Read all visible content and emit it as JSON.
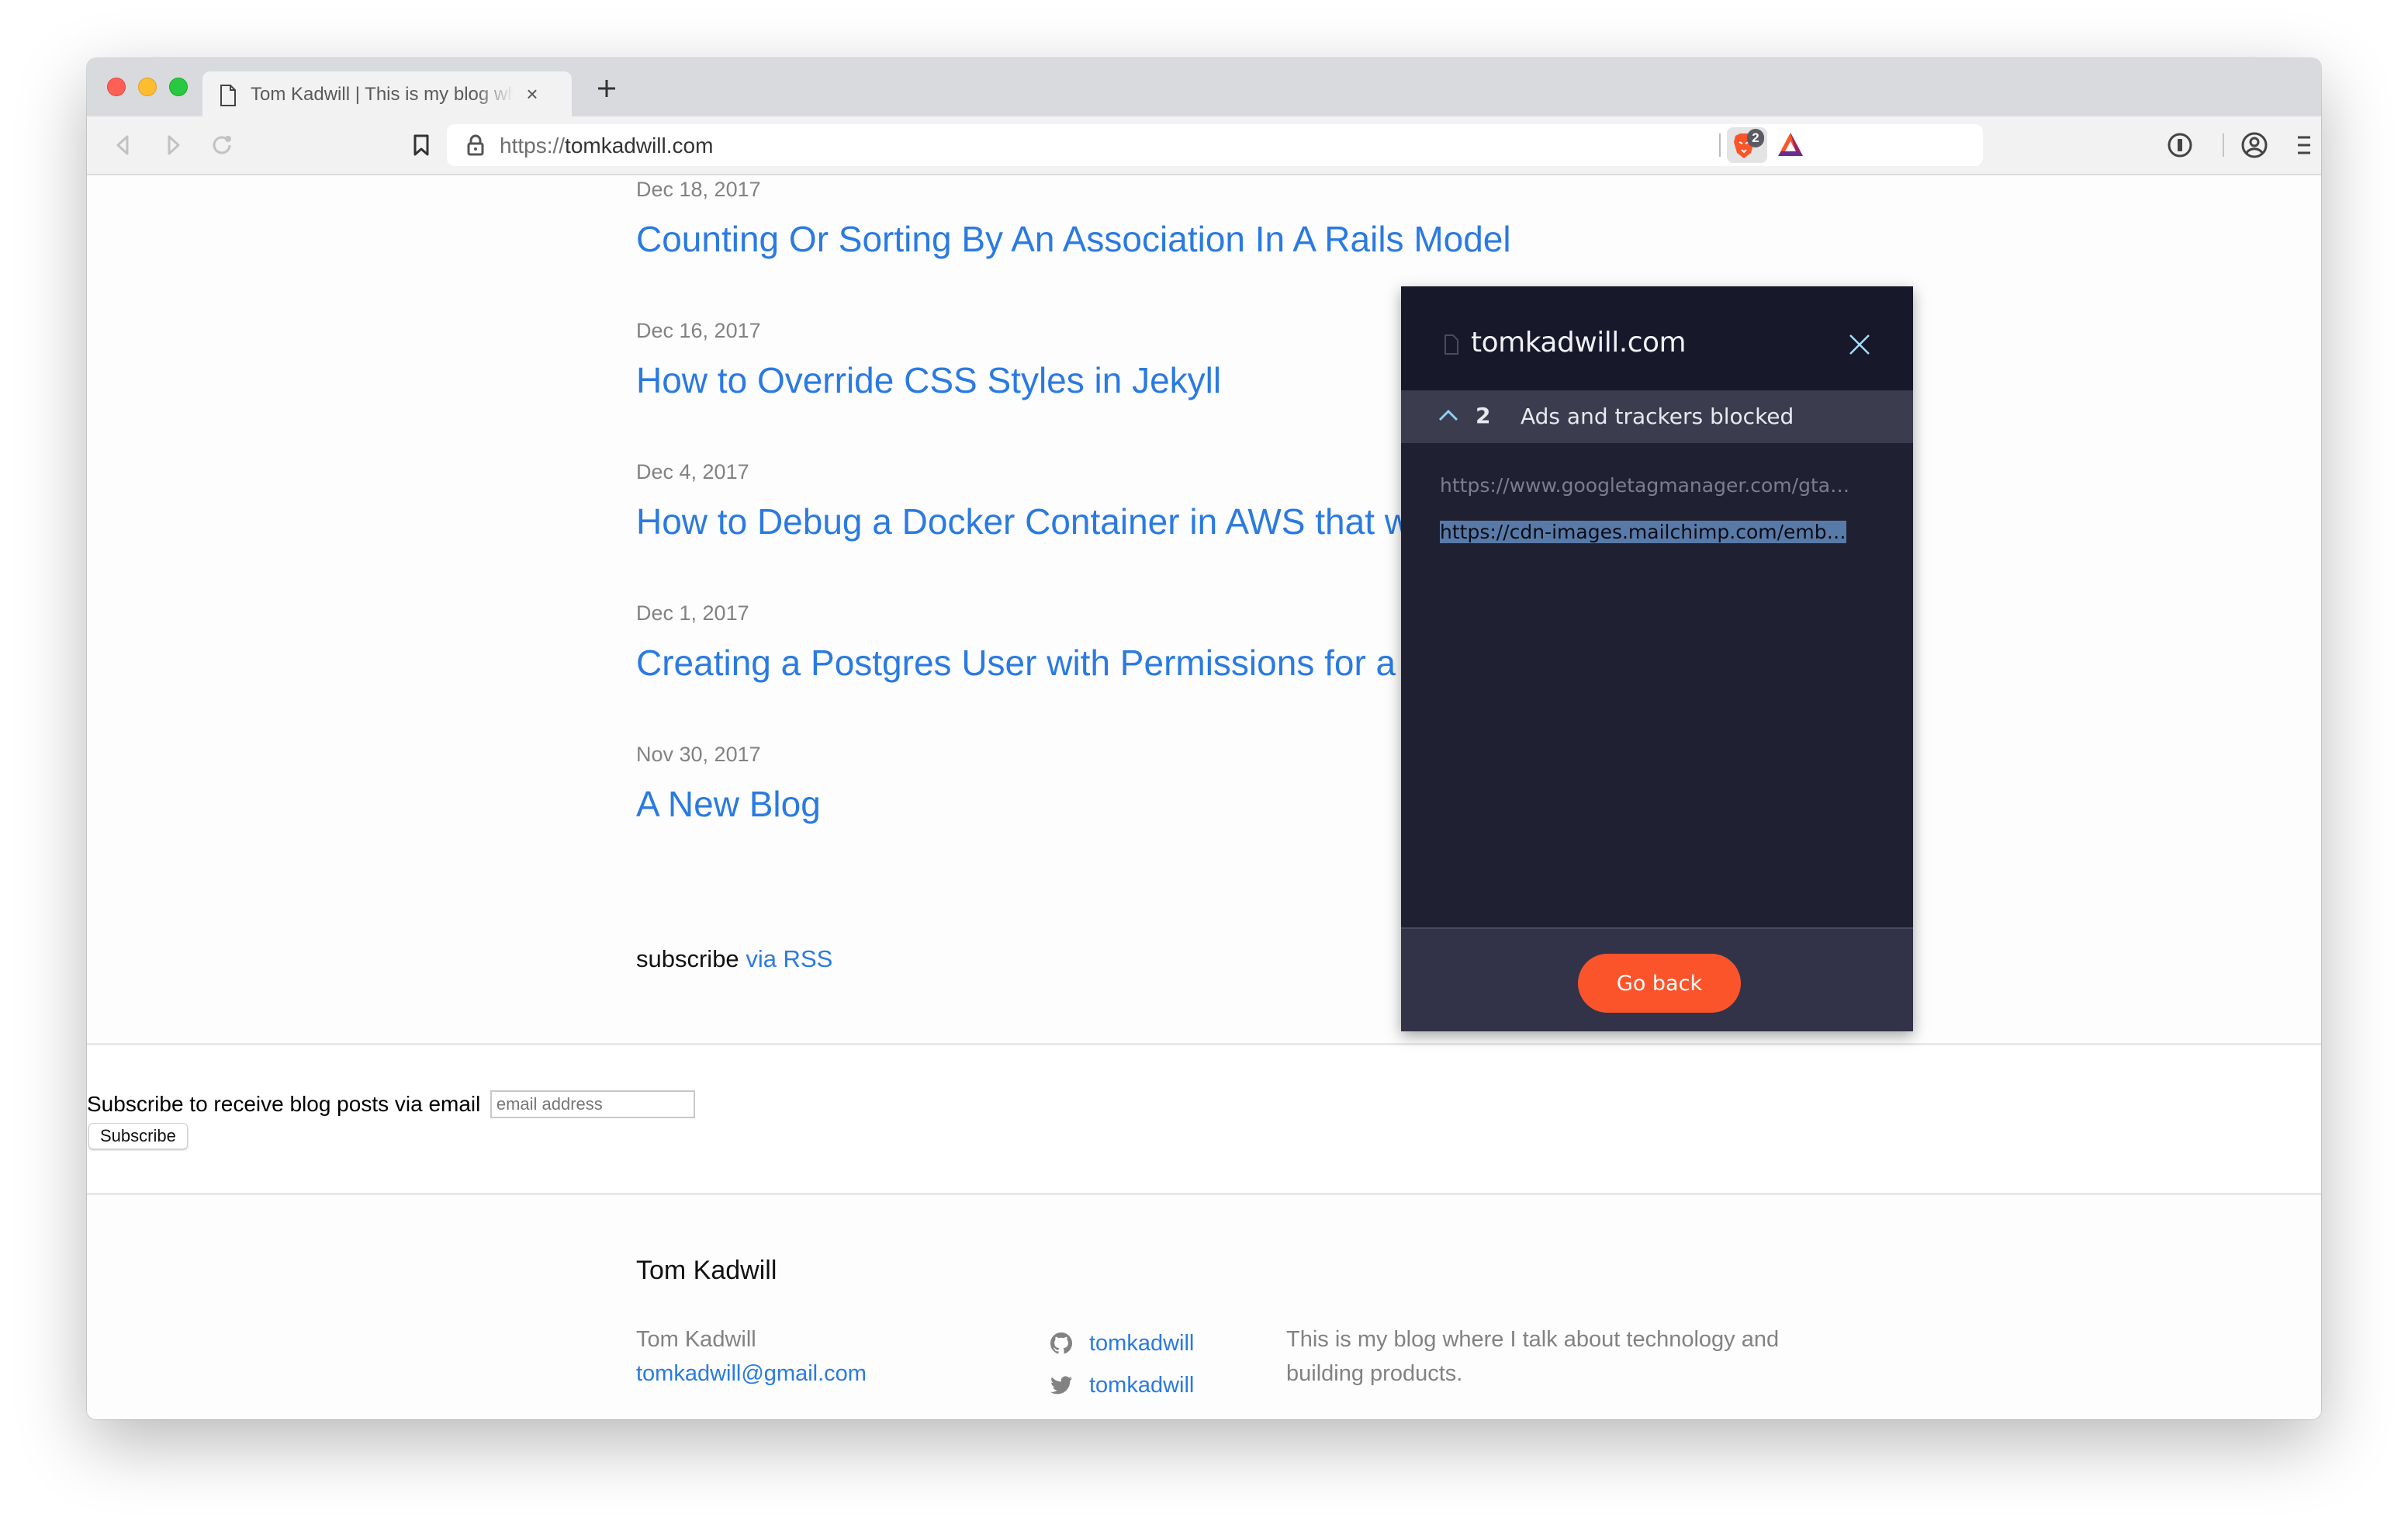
{
  "browser": {
    "tab": {
      "title": "Tom Kadwill | This is my blog where I talk about technology and building products.",
      "icon": "document-icon",
      "close": "×"
    },
    "new_tab": "+",
    "nav": {
      "back": "back-icon",
      "forward": "forward-icon",
      "reload": "reload-icon",
      "bookmark": "bookmark-icon"
    },
    "url": {
      "scheme": "https://",
      "host": "tomkadwill.com",
      "lock": "lock-icon"
    },
    "shields_badge": "2",
    "extensions": [
      "brave-shields-icon",
      "bat-rewards-icon"
    ],
    "right_icons": [
      "password-manager-icon",
      "profile-icon",
      "menu-icon"
    ]
  },
  "posts": [
    {
      "date": "Dec 18, 2017",
      "title": "Counting Or Sorting By An Association In A Rails Model"
    },
    {
      "date": "Dec 16, 2017",
      "title": "How to Override CSS Styles in Jekyll"
    },
    {
      "date": "Dec 4, 2017",
      "title": "How to Debug a Docker Container in AWS that won't start"
    },
    {
      "date": "Dec 1, 2017",
      "title": "Creating a Postgres User with Permissions for a Read Replica"
    },
    {
      "date": "Nov 30, 2017",
      "title": "A New Blog"
    }
  ],
  "rss": {
    "prefix": "subscribe",
    "link": "via RSS"
  },
  "subscribe": {
    "label": "Subscribe to receive blog posts via email",
    "placeholder": "email address",
    "value": "",
    "button": "Subscribe"
  },
  "footer": {
    "title": "Tom Kadwill",
    "name": "Tom Kadwill",
    "email": "tomkadwill@gmail.com",
    "github": "tomkadwill",
    "twitter": "tomkadwill",
    "description": "This is my blog where I talk about technology and building products."
  },
  "shields_panel": {
    "site": "tomkadwill.com",
    "blocked_count": "2",
    "blocked_label": "Ads and trackers blocked",
    "blocked_items": [
      "https://www.googletagmanager.com/gta…",
      "https://cdn-images.mailchimp.com/emb…"
    ],
    "go_back": "Go back",
    "colors": {
      "accent": "#fb542b",
      "header_bg": "#17182a",
      "row_bg": "#3b3c4e",
      "selection": "#587aa8"
    }
  },
  "colors": {
    "link": "#2a7ae2",
    "meta": "#828282"
  }
}
